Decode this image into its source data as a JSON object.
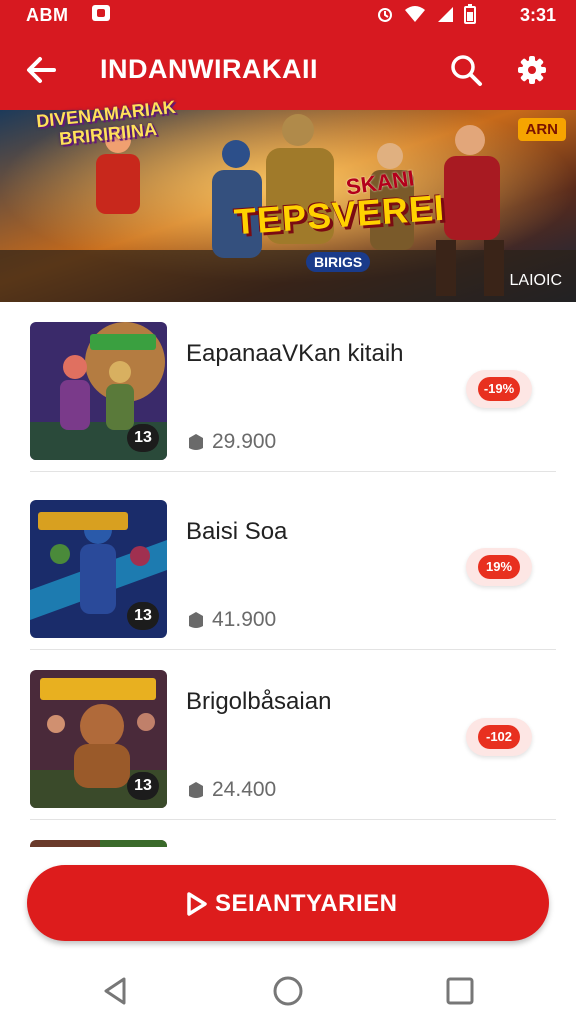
{
  "status_bar": {
    "left_text": "ABM",
    "time": "3:31"
  },
  "app_bar": {
    "title": "INDANWIRAKAII"
  },
  "banner": {
    "badge": "ARN",
    "logo_text": "DIVENAMARIAK BRIRIRIINA",
    "sub_text": "SKANI",
    "headline": "TEPSVEREI",
    "tag": "BIRIGS",
    "corner_text": "LAIOIC"
  },
  "items": [
    {
      "title": "EapanaaVKan kitaih",
      "price": "29.900",
      "discount": "-19%",
      "count": "13"
    },
    {
      "title": "Baisi Soa",
      "price": "41.900",
      "discount": "19%",
      "count": "13"
    },
    {
      "title": "Brigolbåsaian",
      "price": "24.400",
      "discount": "-102",
      "count": "13"
    }
  ],
  "cta": {
    "label": "SEIANTYARIEN"
  },
  "colors": {
    "brand_red": "#d71920",
    "discount_red": "#e8301f"
  },
  "icons": [
    "back-arrow-icon",
    "search-icon",
    "gear-icon",
    "tag-icon",
    "play-icon",
    "nav-back-icon",
    "nav-home-icon",
    "nav-recents-icon"
  ]
}
